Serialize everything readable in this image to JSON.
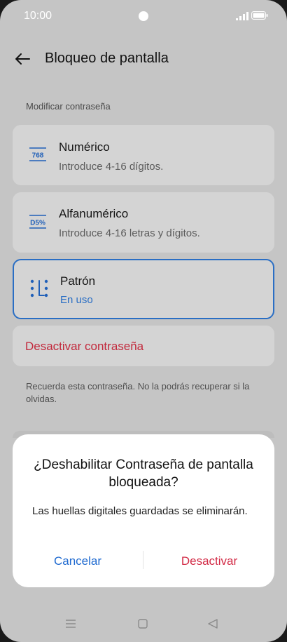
{
  "status_bar": {
    "time": "10:00"
  },
  "header": {
    "title": "Bloqueo de pantalla"
  },
  "section_label": "Modificar contraseña",
  "options": [
    {
      "title": "Numérico",
      "subtitle": "Introduce 4-16 dígitos.",
      "icon_text": "768",
      "icon": "numeric-icon"
    },
    {
      "title": "Alfanumérico",
      "subtitle": "Introduce 4-16 letras y dígitos.",
      "icon_text": "D5%",
      "icon": "alphanumeric-icon"
    },
    {
      "title": "Patrón",
      "subtitle": "En uso",
      "icon": "pattern-icon",
      "selected": true
    }
  ],
  "deactivate_label": "Desactivar contraseña",
  "note": "Recuerda esta contraseña. No la podrás recuperar si la olvidas.",
  "dialog": {
    "title": "¿Deshabilitar Contraseña de pantalla bloqueada?",
    "message": "Las huellas digitales guardadas se eliminarán.",
    "cancel_label": "Cancelar",
    "confirm_label": "Desactivar"
  },
  "colors": {
    "accent": "#1f6ad0",
    "destructive": "#d22a45",
    "selected_border": "#2a6ec4"
  }
}
